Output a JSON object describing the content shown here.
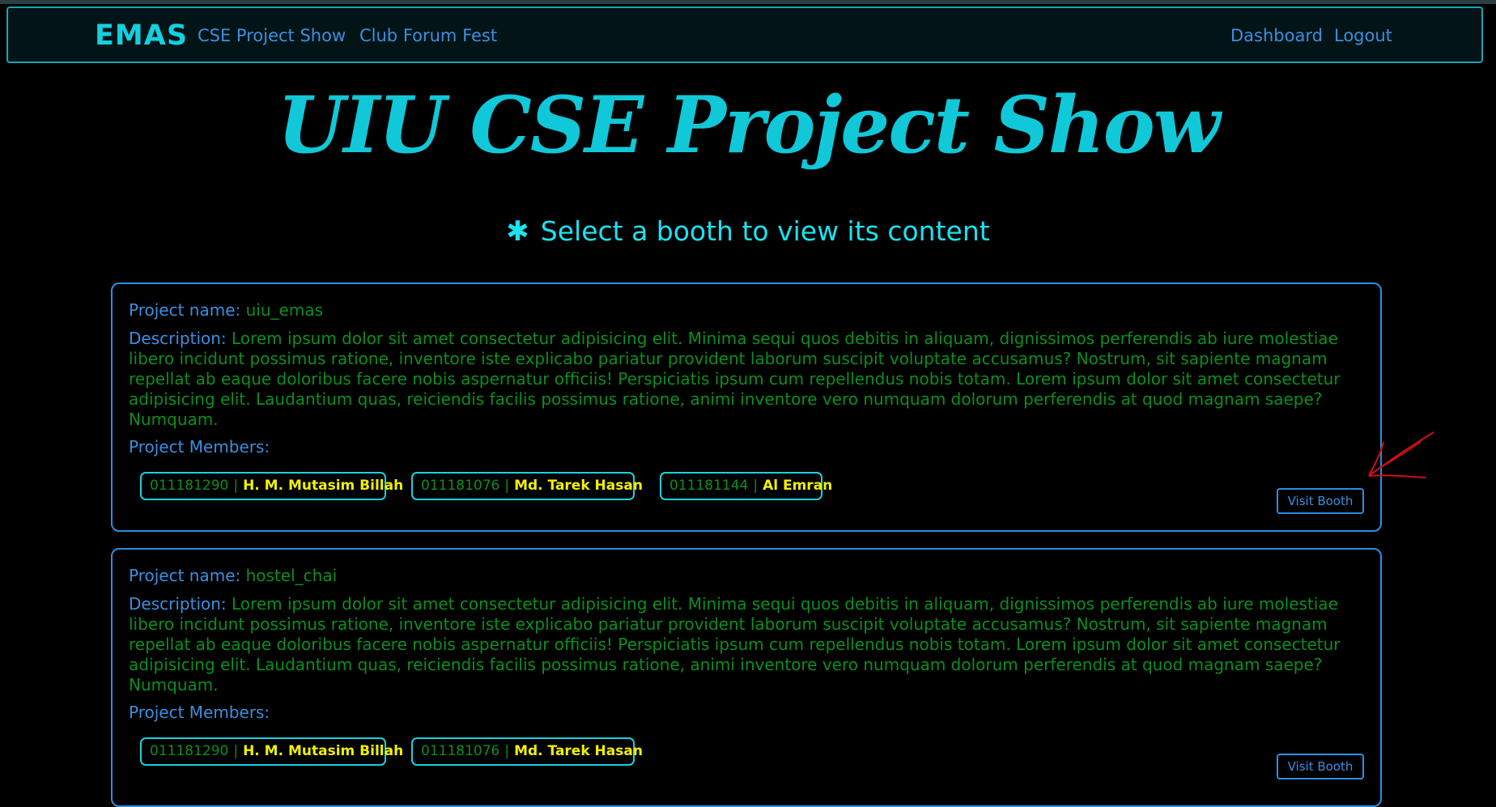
{
  "navbar": {
    "brand": "EMAS",
    "links": [
      "CSE Project Show",
      "Club Forum Fest"
    ],
    "right_links": [
      "Dashboard",
      "Logout"
    ]
  },
  "hero_title": "UIU CSE Project Show",
  "subheading": "Select a booth to view its content",
  "labels": {
    "project_name": "Project name",
    "description": "Description",
    "members": "Project Members:",
    "visit_button": "Visit Booth"
  },
  "projects": [
    {
      "name": "uiu_emas",
      "description": "Lorem ipsum dolor sit amet consectetur adipisicing elit. Minima sequi quos debitis in aliquam, dignissimos perferendis ab iure molestiae libero incidunt possimus ratione, inventore iste explicabo pariatur provident laborum suscipit voluptate accusamus? Nostrum, sit sapiente magnam repellat ab eaque doloribus facere nobis aspernatur officiis! Perspiciatis ipsum cum repellendus nobis totam. Lorem ipsum dolor sit amet consectetur adipisicing elit. Laudantium quas, reiciendis facilis possimus ratione, animi inventore vero numquam dolorum perferendis at quod magnam saepe? Numquam.",
      "members": [
        {
          "id": "011181290",
          "name": "H. M. Mutasim Billah"
        },
        {
          "id": "011181076",
          "name": "Md. Tarek Hasan"
        },
        {
          "id": "011181144",
          "name": "Al Emran"
        }
      ]
    },
    {
      "name": "hostel_chai",
      "description": "Lorem ipsum dolor sit amet consectetur adipisicing elit. Minima sequi quos debitis in aliquam, dignissimos perferendis ab iure molestiae libero incidunt possimus ratione, inventore iste explicabo pariatur provident laborum suscipit voluptate accusamus? Nostrum, sit sapiente magnam repellat ab eaque doloribus facere nobis aspernatur officiis! Perspiciatis ipsum cum repellendus nobis totam. Lorem ipsum dolor sit amet consectetur adipisicing elit. Laudantium quas, reiciendis facilis possimus ratione, animi inventore vero numquam dolorum perferendis at quod magnam saepe? Numquam.",
      "members": [
        {
          "id": "011181290",
          "name": "H. M. Mutasim Billah"
        },
        {
          "id": "011181076",
          "name": "Md. Tarek Hasan"
        }
      ]
    }
  ],
  "colors": {
    "accent_cyan": "#13d0e0",
    "link_blue": "#3a8fe0",
    "text_green": "#0a8f1e",
    "name_yellow": "#f0f000",
    "annotation_red": "#d01010"
  },
  "icons": {
    "subheading": "asterisk-icon",
    "annotation": "red-arrow-icon"
  }
}
